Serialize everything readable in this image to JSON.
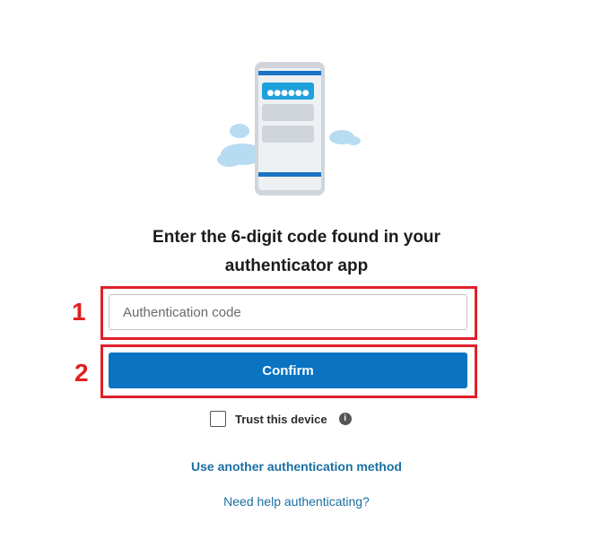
{
  "illustration": {
    "name": "phone-code-illustration",
    "code_dots": "●●●●●●"
  },
  "title": {
    "line1": "Enter the 6-digit code found in your",
    "line2": "authenticator app"
  },
  "annotations": {
    "step1": "1",
    "step2": "2",
    "highlight_color": "#e0202a"
  },
  "form": {
    "code_input": {
      "placeholder": "Authentication code",
      "value": ""
    },
    "confirm_label": "Confirm",
    "trust_label": "Trust this device",
    "trust_checked": false,
    "info_icon": "i"
  },
  "links": {
    "alternate_method": "Use another authentication method",
    "help": "Need help authenticating?"
  },
  "colors": {
    "primary": "#0a73c2",
    "link": "#1a6fa3",
    "cloud": "#a9d4ef"
  }
}
